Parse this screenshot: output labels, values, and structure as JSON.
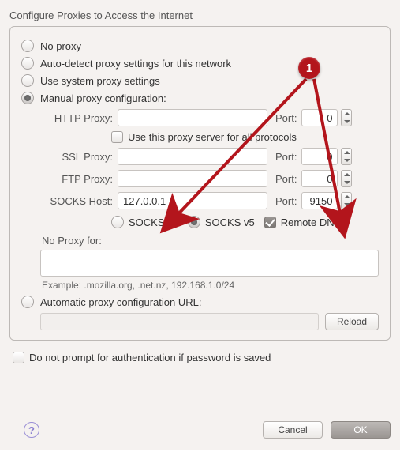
{
  "title": "Configure Proxies to Access the Internet",
  "radios": {
    "no_proxy": "No proxy",
    "auto_detect": "Auto-detect proxy settings for this network",
    "system": "Use system proxy settings",
    "manual": "Manual proxy configuration:",
    "auto_url": "Automatic proxy configuration URL:"
  },
  "selected_mode": "manual",
  "labels": {
    "http": "HTTP Proxy:",
    "ssl": "SSL Proxy:",
    "ftp": "FTP Proxy:",
    "socks": "SOCKS Host:",
    "port": "Port:",
    "no_proxy_for": "No Proxy for:"
  },
  "use_for_all": {
    "checked": false,
    "label": "Use this proxy server for all protocols"
  },
  "fields": {
    "http_host": "",
    "http_port": "0",
    "ssl_host": "",
    "ssl_port": "0",
    "ftp_host": "",
    "ftp_port": "0",
    "socks_host": "127.0.0.1",
    "socks_port": "9150"
  },
  "socks_opts": {
    "v4": "SOCKS v4",
    "v5": "SOCKS v5",
    "selected": "v5",
    "remote_dns_label": "Remote DNS",
    "remote_dns_checked": true
  },
  "no_proxy_value": "",
  "example": "Example: .mozilla.org, .net.nz, 192.168.1.0/24",
  "auto_url_value": "",
  "buttons": {
    "reload": "Reload",
    "cancel": "Cancel",
    "ok": "OK",
    "help": "?"
  },
  "prompt_chk": {
    "checked": false,
    "label": "Do not prompt for authentication if password is saved"
  },
  "annotation": {
    "badge": "1"
  }
}
